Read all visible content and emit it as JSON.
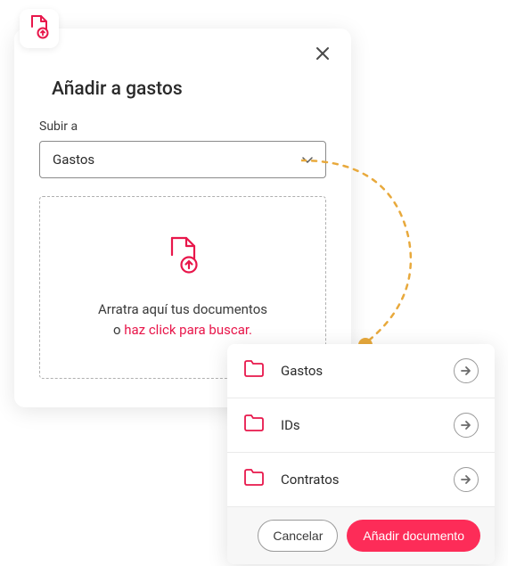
{
  "modal": {
    "title": "Añadir a gastos",
    "field_label": "Subir a",
    "select_value": "Gastos",
    "dropzone_text1": "Arratra aquí tus documentos",
    "dropzone_text2_prefix": "o ",
    "dropzone_link": "haz click para buscar."
  },
  "folder_panel": {
    "items": [
      {
        "label": "Gastos"
      },
      {
        "label": "IDs"
      },
      {
        "label": "Contratos"
      }
    ],
    "cancel_label": "Cancelar",
    "primary_label": "Añadir documento"
  },
  "colors": {
    "accent": "#e8174b",
    "primary_btn": "#fd2c58",
    "connector": "#e8a93c"
  }
}
